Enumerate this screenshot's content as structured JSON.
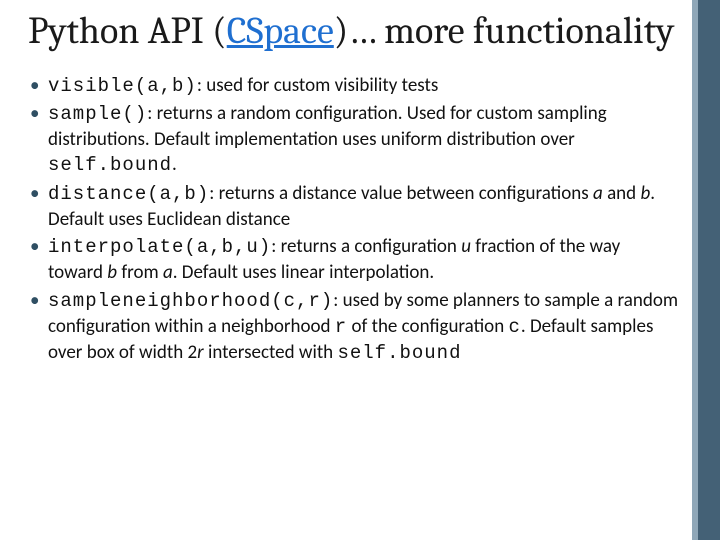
{
  "title": {
    "pre": "Python API (",
    "link": "CSpace",
    "post": ")… more functionality"
  },
  "items": [
    {
      "sig": "visible(a,b)",
      "desc_parts": [
        {
          "t": ": used for custom visibility tests"
        }
      ]
    },
    {
      "sig": "sample()",
      "desc_parts": [
        {
          "t": ": returns a random configuration.  Used for custom sampling distributions. Default implementation uses uniform distribution over "
        },
        {
          "t": "self.bound",
          "mono": true
        },
        {
          "t": "."
        }
      ]
    },
    {
      "sig": "distance(a,b)",
      "desc_parts": [
        {
          "t": ": returns a distance value between configurations "
        },
        {
          "t": "a",
          "ital": true
        },
        {
          "t": " and "
        },
        {
          "t": "b",
          "ital": true
        },
        {
          "t": ". Default uses Euclidean distance"
        }
      ]
    },
    {
      "sig": "interpolate(a,b,u)",
      "desc_parts": [
        {
          "t": ": returns a configuration "
        },
        {
          "t": "u",
          "ital": true
        },
        {
          "t": " fraction of the way toward "
        },
        {
          "t": "b",
          "ital": true
        },
        {
          "t": " from "
        },
        {
          "t": "a",
          "ital": true
        },
        {
          "t": ". Default uses linear interpolation."
        }
      ]
    },
    {
      "sig": "sampleneighborhood(c,r)",
      "desc_parts": [
        {
          "t": ": used by some planners to sample a random configuration within a neighborhood "
        },
        {
          "t": "r",
          "mono": true
        },
        {
          "t": " of the configuration "
        },
        {
          "t": "c",
          "mono": true
        },
        {
          "t": ". Default samples over box of width 2"
        },
        {
          "t": "r",
          "ital": true
        },
        {
          "t": " intersected with "
        },
        {
          "t": "self.bound",
          "mono": true
        }
      ]
    }
  ]
}
